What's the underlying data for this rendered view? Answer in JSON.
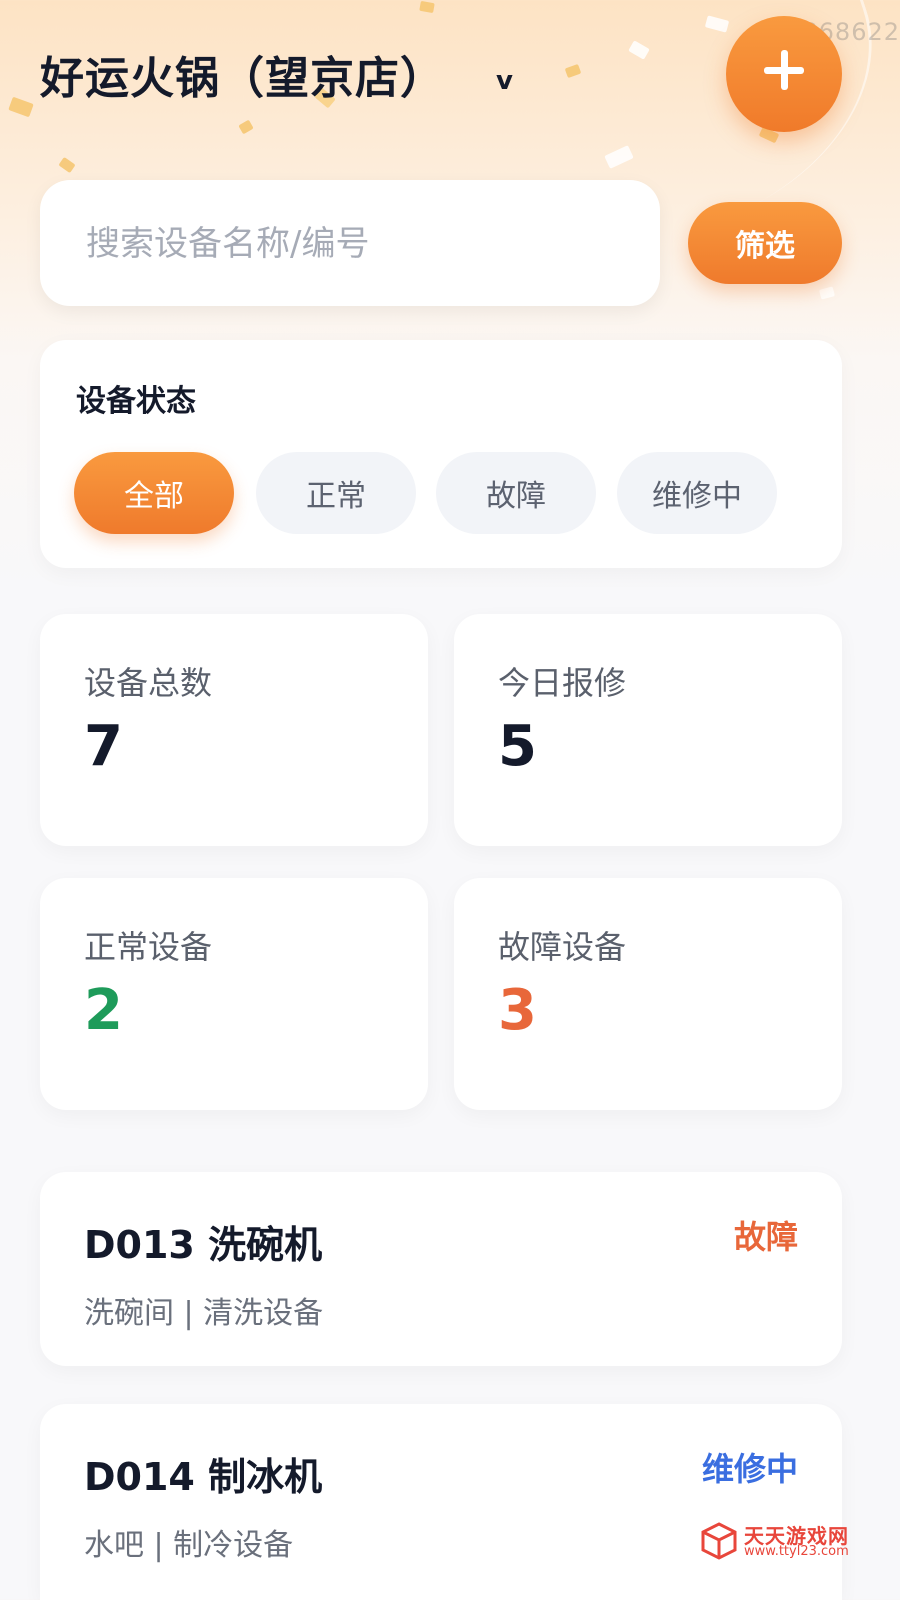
{
  "watermark_id": "ID:868622",
  "header": {
    "store_name": "好运火锅（望京店）",
    "caret": "v"
  },
  "search": {
    "value": "",
    "placeholder": "搜索设备名称/编号",
    "filter_label": "筛选"
  },
  "status_filter": {
    "title": "设备状态",
    "options": [
      "全部",
      "正常",
      "故障",
      "维修中"
    ],
    "selected": "全部"
  },
  "stats": [
    {
      "label": "设备总数",
      "value": "7"
    },
    {
      "label": "今日报修",
      "value": "5"
    },
    {
      "label": "正常设备",
      "value": "2"
    },
    {
      "label": "故障设备",
      "value": "3"
    }
  ],
  "devices": [
    {
      "name": "D013 洗碗机",
      "status": "故障",
      "meta": "洗碗间 | 清洗设备"
    },
    {
      "name": "D014 制冰机",
      "status": "维修中",
      "meta": "水吧 | 制冷设备"
    }
  ],
  "colors": {
    "accent": "#f28a33",
    "normal": "#1e9b5a",
    "fault": "#e8673a",
    "repairing": "#3a6ee0"
  },
  "site_watermark": {
    "name": "天天游戏网",
    "url": "www.ttyl23.com"
  }
}
